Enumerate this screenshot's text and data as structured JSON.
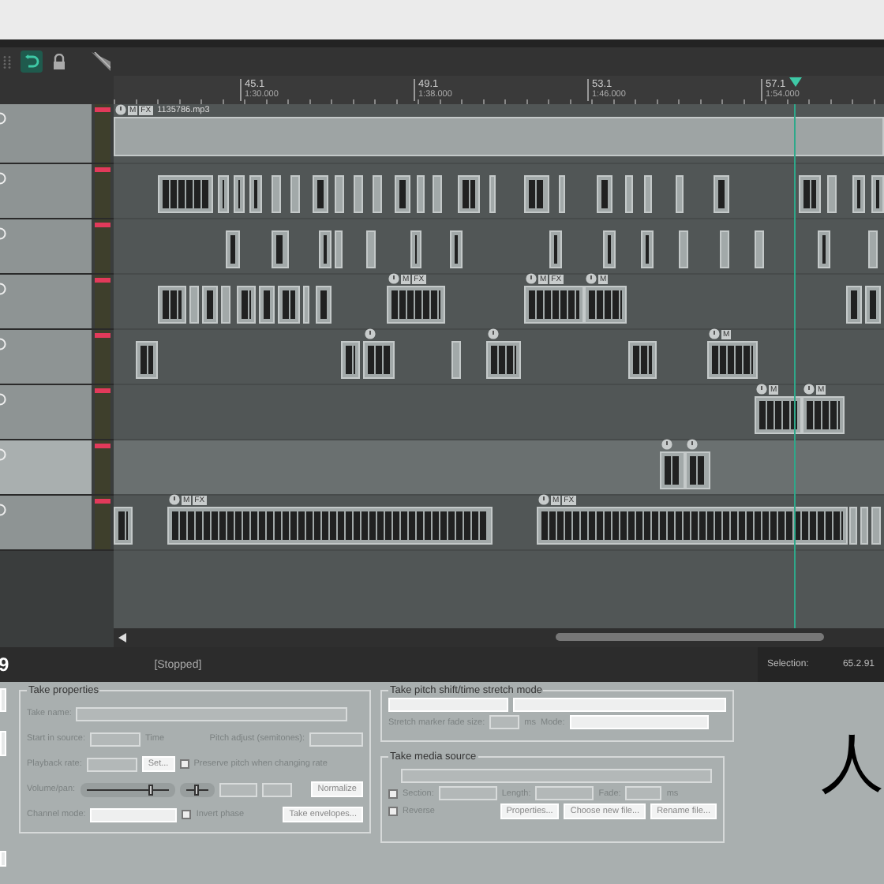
{
  "ruler": {
    "markers": [
      {
        "bar": "45.1",
        "time": "1:30.000"
      },
      {
        "bar": "49.1",
        "time": "1:38.000"
      },
      {
        "bar": "53.1",
        "time": "1:46.000"
      },
      {
        "bar": "57.1",
        "time": "1:54.000"
      }
    ]
  },
  "tracks": [
    {
      "selected": false,
      "items": [
        {
          "label": "1135786.mp3",
          "info": true,
          "badges": [
            "M",
            "FX"
          ]
        }
      ]
    },
    {
      "selected": false,
      "items": [
        {
          "info": false
        },
        {
          "info": false
        },
        {
          "info": false
        },
        {
          "info": false
        },
        {
          "info": false
        },
        {
          "info": false
        },
        {
          "info": false
        },
        {
          "info": false
        },
        {
          "info": false
        },
        {
          "info": false
        },
        {
          "info": false
        },
        {
          "info": false
        },
        {
          "info": false
        },
        {
          "info": false
        },
        {
          "info": false
        },
        {
          "info": false
        },
        {
          "info": false
        },
        {
          "info": false
        },
        {
          "info": false
        },
        {
          "info": false
        },
        {
          "info": false
        },
        {
          "info": false
        },
        {
          "info": false
        },
        {
          "info": false
        },
        {
          "info": false
        },
        {
          "info": false
        }
      ]
    },
    {
      "selected": false,
      "items": [
        {
          "info": false
        },
        {
          "info": false
        },
        {
          "info": false
        },
        {
          "info": false
        },
        {
          "info": false
        },
        {
          "info": false
        },
        {
          "info": false
        },
        {
          "info": false
        },
        {
          "info": false
        },
        {
          "info": false
        },
        {
          "info": false
        },
        {
          "info": false
        },
        {
          "info": false
        },
        {
          "info": false
        },
        {
          "info": false
        }
      ]
    },
    {
      "selected": false,
      "items": [
        {
          "info": false
        },
        {
          "info": false
        },
        {
          "info": false
        },
        {
          "info": false
        },
        {
          "info": false
        },
        {
          "info": false
        },
        {
          "info": false
        },
        {
          "info": false
        },
        {
          "info": false
        },
        {
          "info": true,
          "badges": [
            "M",
            "FX"
          ]
        },
        {
          "info": true,
          "badges": [
            "M",
            "FX"
          ]
        },
        {
          "info": true,
          "badges": [
            "M"
          ]
        },
        {
          "info": false
        },
        {
          "info": false
        }
      ]
    },
    {
      "selected": false,
      "items": [
        {
          "info": false
        },
        {
          "info": false
        },
        {
          "info": true
        },
        {
          "info": false
        },
        {
          "info": true
        },
        {
          "info": false
        },
        {
          "info": true,
          "badges": [
            "M"
          ]
        }
      ]
    },
    {
      "selected": false,
      "items": [
        {
          "info": true,
          "badges": [
            "M"
          ]
        },
        {
          "info": true,
          "badges": [
            "M"
          ]
        }
      ]
    },
    {
      "selected": true,
      "items": [
        {
          "info": true
        },
        {
          "info": true
        }
      ]
    },
    {
      "selected": false,
      "items": [
        {
          "info": false
        },
        {
          "info": true,
          "badges": [
            "M",
            "FX"
          ]
        },
        {
          "info": true,
          "badges": [
            "M",
            "FX"
          ]
        },
        {
          "info": false
        },
        {
          "info": false
        },
        {
          "info": false
        }
      ]
    }
  ],
  "status_bar": {
    "track_number": "9",
    "transport": "[Stopped]",
    "selection_label": "Selection:",
    "selection_value": "65.2.91"
  },
  "take_properties": {
    "title": "Take properties",
    "take_name_label": "Take name:",
    "start_label": "Start in source:",
    "time_label": "Time",
    "pitch_label": "Pitch adjust (semitones):",
    "rate_label": "Playback rate:",
    "set_button": "Set...",
    "preserve_pitch": {
      "label": "Preserve pitch when changing rate",
      "checked": false
    },
    "volume_label": "Volume/pan:",
    "volume_slider": {
      "level": 0.75
    },
    "pan_slider": {
      "level": 0.5
    },
    "normalize_button": "Normalize",
    "channel_label": "Channel mode:",
    "invert_phase": {
      "label": "Invert phase",
      "checked": false
    },
    "envelopes_button": "Take envelopes..."
  },
  "stretch_mode": {
    "title": "Take pitch shift/time stretch mode",
    "fade_label": "Stretch marker fade size:",
    "ms_label": "ms",
    "mode_label": "Mode:"
  },
  "media_source": {
    "title": "Take media source",
    "section": {
      "label": "Section:",
      "checked": false
    },
    "length_label": "Length:",
    "fade_label": "Fade:",
    "ms_label": "ms",
    "reverse": {
      "label": "Reverse",
      "checked": false
    },
    "buttons": [
      "Properties...",
      "Choose new file...",
      "Rename file..."
    ]
  },
  "side_text": "人"
}
